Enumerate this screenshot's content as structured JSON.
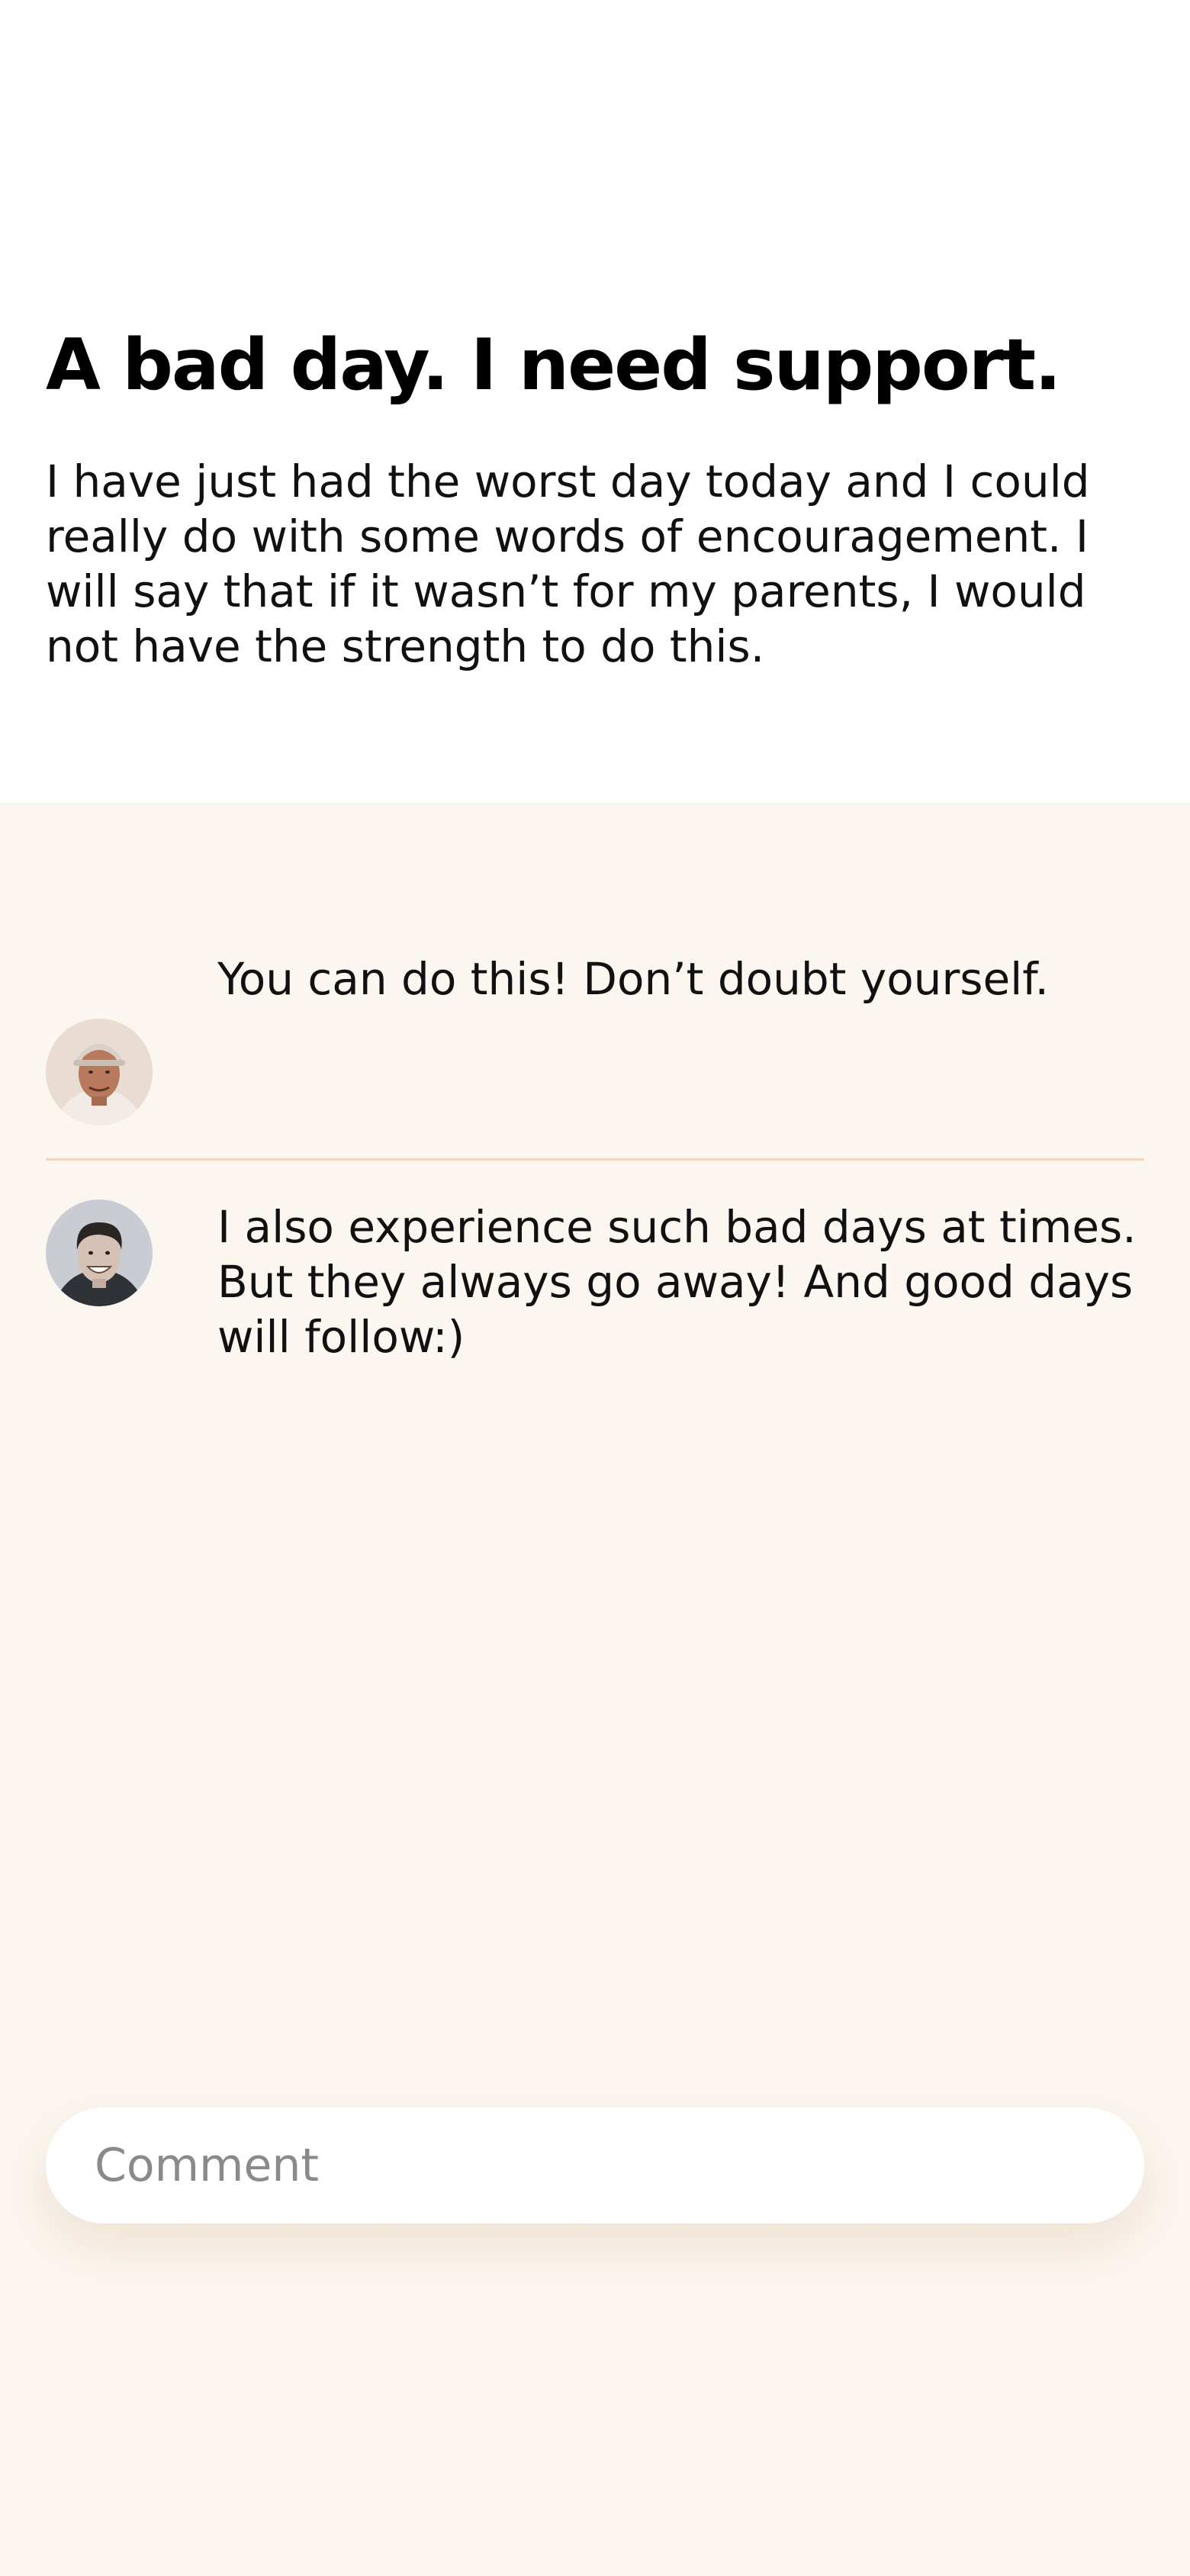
{
  "post": {
    "title": "A bad day. I need support.",
    "body": "I have just had the worst day today and I could really do with some words of encouragement. I will say that if it wasn’t for my parents, I would not have the strength to do this."
  },
  "comments": [
    {
      "text": "You can do this! Don’t doubt yourself.",
      "avatar_icon": "avatar-older-man-cap"
    },
    {
      "text": "I also experience such bad days at times. But they always go away! And good days will follow:)",
      "avatar_icon": "avatar-smiling-man"
    }
  ],
  "comment_input": {
    "placeholder": "Comment",
    "value": ""
  },
  "colors": {
    "page_background": "#ffffff",
    "comments_background": "#fbf6f0",
    "divider": "#f5d3b8",
    "placeholder": "#8a8a8a",
    "text": "#111111"
  }
}
